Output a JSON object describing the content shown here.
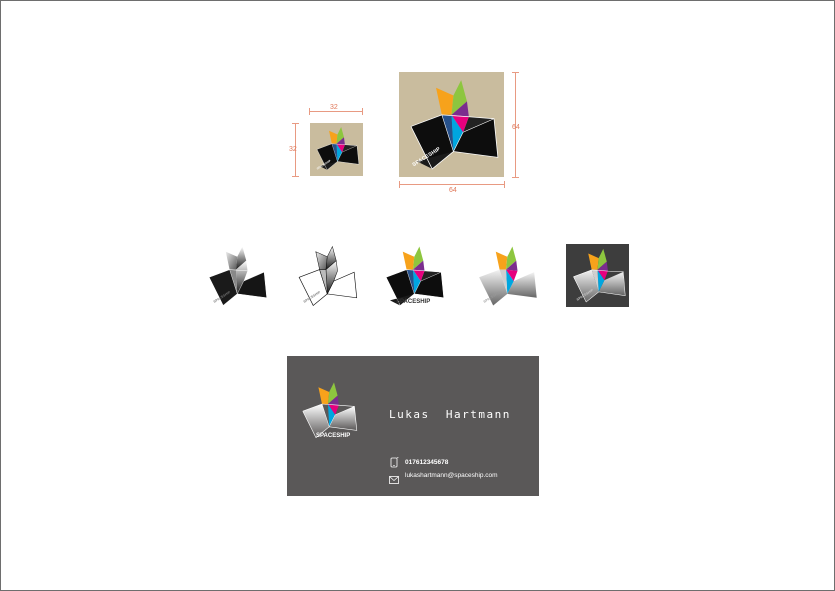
{
  "dimensions": {
    "small_width": "32",
    "small_height": "32",
    "large_width": "64",
    "large_height": "64"
  },
  "brand": {
    "name": "SPACESHIP"
  },
  "card": {
    "name": "Lukas  Hartmann",
    "phone": "017612345678",
    "email": "lukashartmann@spaceship.com"
  },
  "colors": {
    "background": "#ffffff",
    "icon_tile_beige": "#c9bc9e",
    "card_gray": "#5a5858",
    "dimension_red": "#e0785a",
    "orange": "#f7a21b",
    "green": "#8dc63f",
    "magenta": "#e6007e",
    "cyan": "#00a6e0",
    "purple": "#7b2d8e"
  },
  "icons": {
    "phone": "phone-icon",
    "mail": "mail-icon"
  }
}
